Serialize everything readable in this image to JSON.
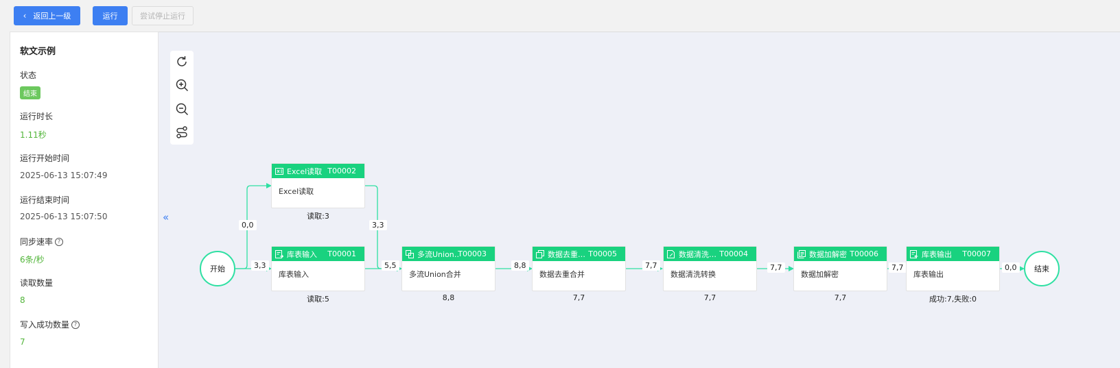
{
  "toolbar": {
    "back_label": "返回上一级",
    "run_label": "运行",
    "stop_label": "尝试停止运行"
  },
  "sidebar": {
    "title": "软文示例",
    "status_label": "状态",
    "status_value": "结束",
    "duration_label": "运行时长",
    "duration_value": "1.11秒",
    "start_label": "运行开始时间",
    "start_value": "2025-06-13 15:07:49",
    "end_label": "运行结束时间",
    "end_value": "2025-06-13 15:07:50",
    "rate_label": "同步速率",
    "rate_value": "6条/秒",
    "read_label": "读取数量",
    "read_value": "8",
    "write_label": "写入成功数量",
    "write_value": "7"
  },
  "collapse_glyph": "«",
  "flow": {
    "start_label": "开始",
    "end_label": "结束",
    "nodes": {
      "excel": {
        "name": "Excel读取",
        "code": "T00002",
        "body": "Excel读取",
        "stat": "读取:3"
      },
      "table_in": {
        "name": "库表输入",
        "code": "T00001",
        "body": "库表输入",
        "stat": "读取:5"
      },
      "union": {
        "name": "多流Union…",
        "code": "T00003",
        "body": "多流Union合并",
        "stat": "8,8"
      },
      "dedup": {
        "name": "数据去重…",
        "code": "T00005",
        "body": "数据去重合并",
        "stat": "7,7"
      },
      "clean": {
        "name": "数据清洗…",
        "code": "T00004",
        "body": "数据清洗转换",
        "stat": "7,7"
      },
      "crypto": {
        "name": "数据加解密",
        "code": "T00006",
        "body": "数据加解密",
        "stat": "7,7"
      },
      "table_out": {
        "name": "库表输出",
        "code": "T00007",
        "body": "库表输出",
        "stat": "成功:7,失败:0"
      }
    },
    "edge_labels": {
      "start_excel": "0,0",
      "start_table": "3,3",
      "excel_union": "3,3",
      "table_union": "5,5",
      "union_dedup": "8,8",
      "dedup_clean": "7,7",
      "clean_crypto": "7,7",
      "crypto_out": "7,7",
      "out_end": "0,0"
    }
  },
  "colors": {
    "primary": "#3d7ff2",
    "node_header": "#19d27f",
    "edge": "#2ee0a2",
    "value_green": "#52b53a",
    "canvas_bg": "#eef0f7"
  }
}
